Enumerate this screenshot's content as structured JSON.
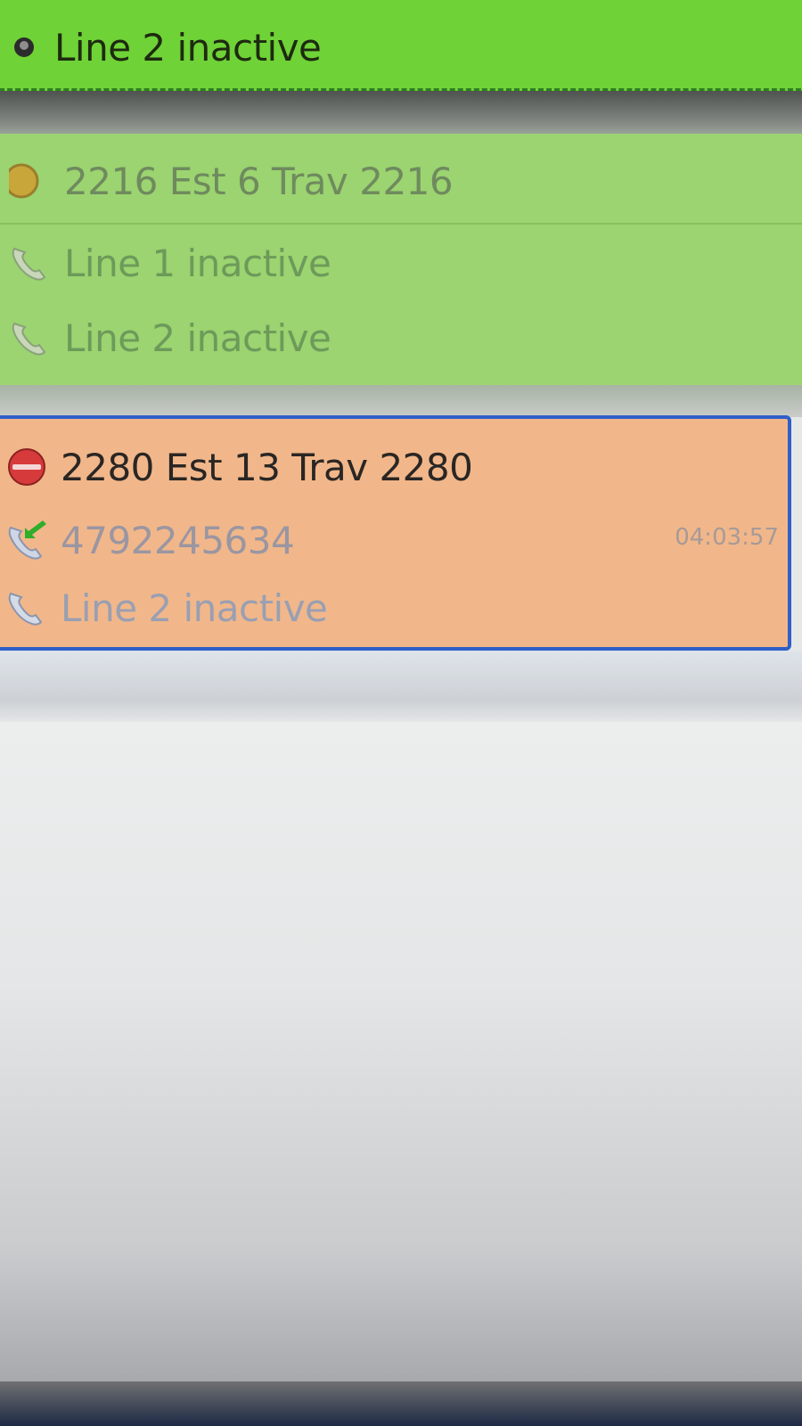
{
  "top_card": {
    "line2_label": "Line 2 inactive"
  },
  "mid_card": {
    "title": "2216 Est 6 Trav 2216",
    "line1_label": "Line 1 inactive",
    "line2_label": "Line 2 inactive"
  },
  "active_card": {
    "title": "2280 Est 13 Trav 2280",
    "call_number": "4792245634",
    "call_timer": "04:03:57",
    "line2_label": "Line 2 inactive"
  },
  "colors": {
    "selected_card": "#6fd236",
    "muted_card": "#9bd470",
    "active_card": "#f1b78a",
    "active_border": "#2f5fc8",
    "status_busy": "#d63a3a",
    "status_idle": "#c9a63a",
    "incoming_arrow": "#2fae2a"
  },
  "icons": {
    "status_busy": "busy-status-icon",
    "status_idle": "idle-status-icon",
    "phone": "phone-icon",
    "incoming_call": "incoming-call-icon"
  }
}
